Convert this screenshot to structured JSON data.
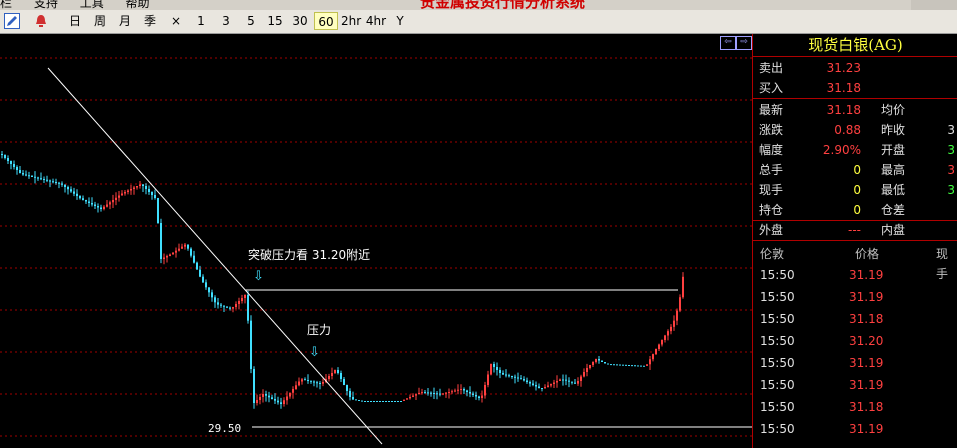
{
  "window": {
    "menu": [
      "栏",
      "支持",
      "工具",
      "帮助"
    ],
    "title": "贵金属投资行情分析系统"
  },
  "toolbar": {
    "periods": [
      "日",
      "周",
      "月",
      "季",
      "×",
      "1",
      "3",
      "5",
      "15",
      "30",
      "60",
      "2hr",
      "4hr",
      "Y"
    ],
    "active_period": "60",
    "icons": [
      "pencil-icon",
      "alarm-icon"
    ]
  },
  "chart": {
    "annotation_breakout": "突破压力看 31.20附近",
    "annotation_resistance": "压力",
    "price_label": "29.50"
  },
  "quote": {
    "name": "现货白银(AG)",
    "sell_label": "卖出",
    "sell": "31.23",
    "buy_label": "买入",
    "buy": "31.18",
    "latest_label": "最新",
    "latest": "31.18",
    "avg_label": "均价",
    "avg": "",
    "change_label": "涨跌",
    "change": "0.88",
    "prevclose_label": "昨收",
    "prevclose": "3",
    "amp_label": "幅度",
    "amp": "2.90%",
    "open_label": "开盘",
    "open": "3",
    "vol_label": "总手",
    "vol": "0",
    "high_label": "最高",
    "high": "3",
    "cur_label": "现手",
    "cur": "0",
    "low_label": "最低",
    "low": "3",
    "pos_label": "持仓",
    "pos": "0",
    "posdiff_label": "仓差",
    "posdiff": "",
    "outer_label": "外盘",
    "outer": "---",
    "inner_label": "内盘",
    "inner": ""
  },
  "ticks": {
    "headers": [
      "伦敦",
      "价格",
      "现手"
    ],
    "rows": [
      {
        "time": "15:50",
        "price": "31.19"
      },
      {
        "time": "15:50",
        "price": "31.19"
      },
      {
        "time": "15:50",
        "price": "31.18"
      },
      {
        "time": "15:50",
        "price": "31.20"
      },
      {
        "time": "15:50",
        "price": "31.19"
      },
      {
        "time": "15:50",
        "price": "31.19"
      },
      {
        "time": "15:50",
        "price": "31.18"
      },
      {
        "time": "15:50",
        "price": "31.19"
      }
    ]
  },
  "colors": {
    "up": "#ff4040",
    "down": "#40e0ff",
    "grid": "#a00000",
    "yellow": "#ffff40"
  }
}
